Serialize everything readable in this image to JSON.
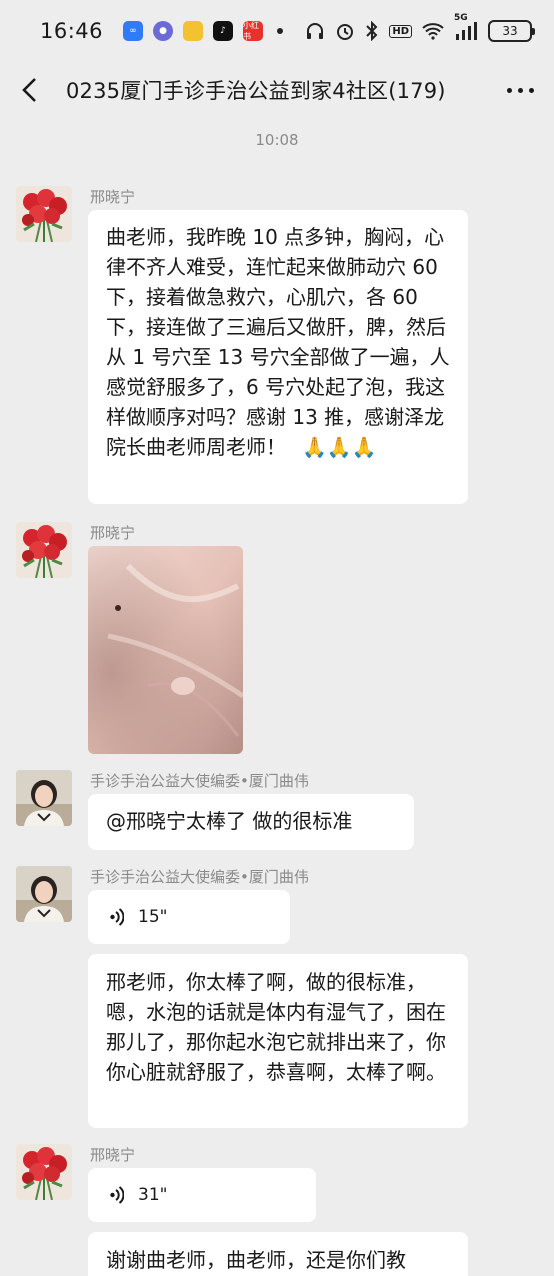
{
  "status_bar": {
    "time": "16:46",
    "apps": [
      "infinity-app-icon",
      "circle-app-icon",
      "notes-app-icon",
      "tiktok-icon",
      "xiaohongshu-icon"
    ],
    "app_red_label": "小红书",
    "network_label": "5G",
    "hd_label": "HD",
    "battery": "33"
  },
  "header": {
    "title": "0235厦门手诊手治公益到家4社区(179)"
  },
  "chat": {
    "time_separator": "10:08",
    "messages": [
      {
        "sender": "邢晓宁",
        "text": "曲老师，我昨晚 10 点多钟，胸闷，心律不齐人难受，连忙起来做肺动穴 60 下，接着做急救穴，心肌穴，各 60 下，接连做了三遍后又做肝，脾，然后从 1 号穴至 13 号穴全部做了一遍，人感觉舒服多了，6 号穴处起了泡，我这样做顺序对吗？感谢 13 推，感谢泽龙院长曲老师周老师！",
        "emoji": "🙏🙏🙏"
      },
      {
        "sender": "邢晓宁",
        "type": "photo"
      },
      {
        "sender": "手诊手治公益大使编委•厦门曲伟",
        "text": "@邢晓宁太棒了  做的很标准"
      },
      {
        "sender": "手诊手治公益大使编委•厦门曲伟",
        "voice_duration": "15\"",
        "transcript": "邢老师，你太棒了啊，做的很标准，嗯，水泡的话就是体内有湿气了，困在那儿了，那你起水泡它就排出来了，你你心脏就舒服了，恭喜啊，太棒了啊。"
      },
      {
        "sender": "邢晓宁",
        "voice_duration": "31\"",
        "transcript": "谢谢曲老师，曲老师，还是你们教"
      }
    ]
  }
}
